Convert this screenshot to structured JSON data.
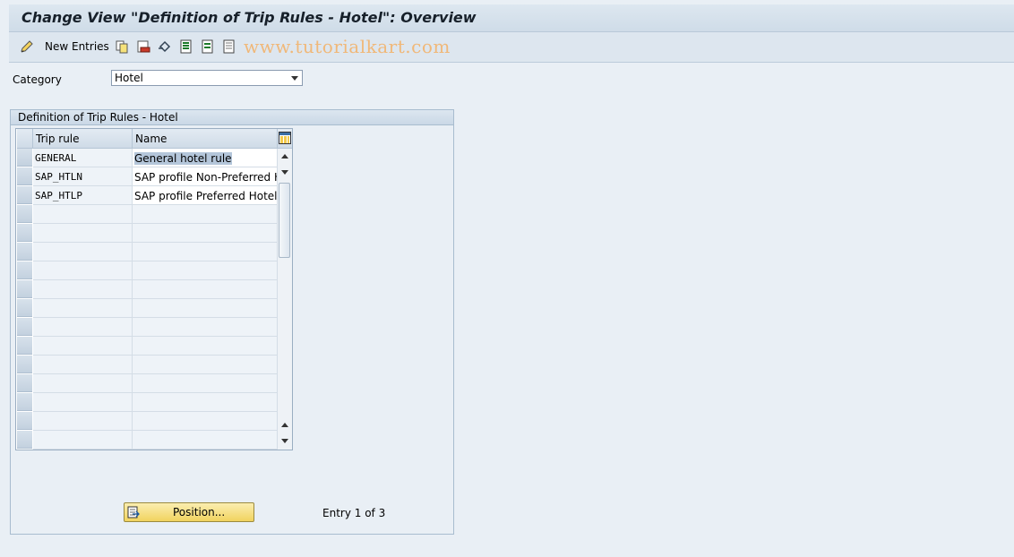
{
  "title": "Change View \"Definition of Trip Rules - Hotel\": Overview",
  "toolbar": {
    "new_entries_label": "New Entries",
    "icons": [
      "edit-icon",
      "copy-icon",
      "delete-icon",
      "undo-icon",
      "select-all-icon",
      "select-block-icon",
      "deselect-all-icon"
    ],
    "watermark": "www.tutorialkart.com"
  },
  "category": {
    "label": "Category",
    "value": "Hotel"
  },
  "group": {
    "title": "Definition of Trip Rules - Hotel",
    "columns": [
      "Trip rule",
      "Name"
    ],
    "rows": [
      {
        "rule": "GENERAL",
        "name": "General hotel rule"
      },
      {
        "rule": "SAP_HTLN",
        "name": "SAP profile Non-Preferred H.."
      },
      {
        "rule": "SAP_HTLP",
        "name": "SAP profile Preferred Hotels"
      }
    ],
    "total_rows": 16
  },
  "position_button": "Position...",
  "entry_status": "Entry 1 of 3",
  "colors": {
    "background": "#e9eff5",
    "button": "#f1d35f",
    "selection": "#b4c6da"
  }
}
